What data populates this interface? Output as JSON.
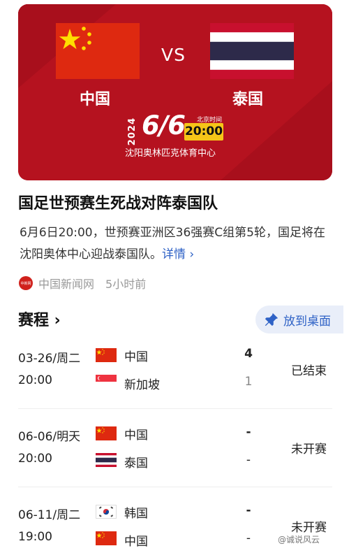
{
  "hero": {
    "vs": "VS",
    "team_home": "中国",
    "team_away": "泰国",
    "year": "2024",
    "date": "6/6",
    "time_label": "北京时间",
    "time": "20:00",
    "venue": "沈阳奥林匹克体育中心"
  },
  "article": {
    "headline": "国足世预赛生死战对阵泰国队",
    "summary": "6月6日20:00，世预赛亚洲区36强赛C组第5轮，国足将在沈阳奥体中心迎战泰国队。",
    "detail_link": "详情 ›",
    "source_logo": "中新网",
    "source": "中国新闻网",
    "time_ago": "5小时前"
  },
  "schedule": {
    "title": "赛程 ›",
    "pin_label": "放到桌面",
    "matches": [
      {
        "date": "03-26/周二",
        "time": "20:00",
        "team1": "中国",
        "team1_flag": "china-flag",
        "team2": "新加坡",
        "team2_flag": "singapore-flag",
        "score1": "4",
        "score2": "1",
        "status": "已结束"
      },
      {
        "date": "06-06/明天",
        "time": "20:00",
        "team1": "中国",
        "team1_flag": "china-flag",
        "team2": "泰国",
        "team2_flag": "thailand-flag",
        "score1": "-",
        "score2": "-",
        "status": "未开赛"
      },
      {
        "date": "06-11/周二",
        "time": "19:00",
        "team1": "韩国",
        "team1_flag": "korea-flag",
        "team2": "中国",
        "team2_flag": "china-flag",
        "score1": "-",
        "score2": "-",
        "status": "未开赛"
      }
    ]
  },
  "watermark": "@诚说风云",
  "colors": {
    "banner": "#b5121f",
    "accent": "#2f62c6",
    "china_red": "#de2910",
    "thai_blue": "#2d2a4a",
    "time_yellow": "#f5c518"
  }
}
